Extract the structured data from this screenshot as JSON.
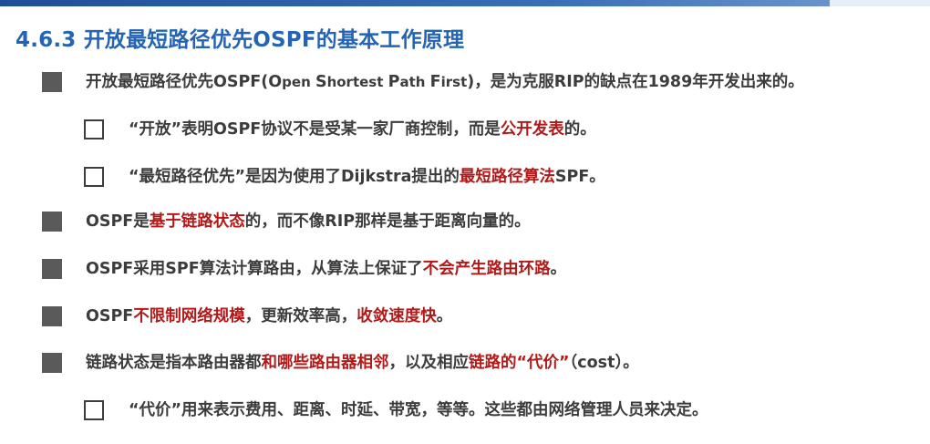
{
  "title": "4.6.3 开放最短路径优先OSPF的基本工作原理",
  "items": [
    {
      "level": 1,
      "parts": [
        {
          "t": "开放最短路径优先OSPF(",
          "c": "n"
        },
        {
          "t": "O",
          "c": "n"
        },
        {
          "t": "pen ",
          "c": "s"
        },
        {
          "t": "S",
          "c": "n"
        },
        {
          "t": "hortest ",
          "c": "s"
        },
        {
          "t": "P",
          "c": "n"
        },
        {
          "t": "ath ",
          "c": "s"
        },
        {
          "t": "F",
          "c": "n"
        },
        {
          "t": "irst",
          "c": "s"
        },
        {
          "t": ")，是为克服RIP的缺点在1989年开发出来的。",
          "c": "n"
        }
      ]
    },
    {
      "level": 2,
      "parts": [
        {
          "t": "“开放”表明OSPF协议不是受某一家厂商控制，而是",
          "c": "n"
        },
        {
          "t": "公开发表",
          "c": "r"
        },
        {
          "t": "的。",
          "c": "n"
        }
      ]
    },
    {
      "level": 2,
      "parts": [
        {
          "t": "“最短路径优先”是因为使用了Dijkstra提出的",
          "c": "n"
        },
        {
          "t": "最短路径算法",
          "c": "r"
        },
        {
          "t": "SPF。",
          "c": "n"
        }
      ]
    },
    {
      "level": 1,
      "parts": [
        {
          "t": "OSPF是",
          "c": "n"
        },
        {
          "t": "基于链路状态",
          "c": "r"
        },
        {
          "t": "的，而不像RIP那样是基于距离向量的。",
          "c": "n"
        }
      ]
    },
    {
      "level": 1,
      "parts": [
        {
          "t": "OSPF采用SPF算法计算路由，从算法上保证了",
          "c": "n"
        },
        {
          "t": "不会产生路由环路",
          "c": "r"
        },
        {
          "t": "。",
          "c": "n"
        }
      ]
    },
    {
      "level": 1,
      "parts": [
        {
          "t": "OSPF",
          "c": "n"
        },
        {
          "t": "不限制网络规模",
          "c": "r"
        },
        {
          "t": "，更新效率高，",
          "c": "n"
        },
        {
          "t": "收敛速度快",
          "c": "r"
        },
        {
          "t": "。",
          "c": "n"
        }
      ]
    },
    {
      "level": 1,
      "parts": [
        {
          "t": "链路状态是指本路由器都",
          "c": "n"
        },
        {
          "t": "和哪些路由器相邻",
          "c": "r"
        },
        {
          "t": "，以及相应",
          "c": "n"
        },
        {
          "t": "链路的“代价”",
          "c": "r"
        },
        {
          "t": "（cost）。",
          "c": "n"
        }
      ]
    },
    {
      "level": 2,
      "parts": [
        {
          "t": "“代价”用来表示费用、距离、时延、带宽，等等。这些都由网络管理人员来决定。",
          "c": "n"
        }
      ]
    }
  ]
}
